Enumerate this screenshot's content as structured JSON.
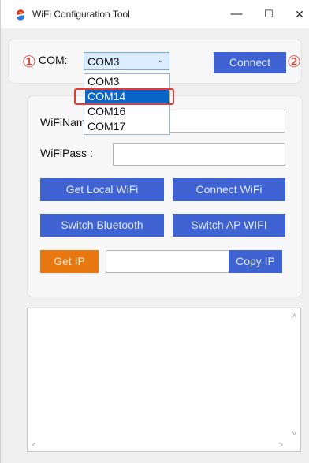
{
  "window": {
    "title": "WiFi Configuration Tool",
    "minimize_glyph": "—",
    "maximize_glyph": "☐",
    "close_glyph": "✕"
  },
  "annotations": {
    "marker1": "①",
    "marker2": "②"
  },
  "com": {
    "label": "COM:",
    "selected": "COM3",
    "options": [
      "COM3",
      "COM14",
      "COM16",
      "COM17"
    ],
    "highlighted_option": "COM14"
  },
  "buttons": {
    "connect": "Connect",
    "get_local_wifi": "Get Local WiFi",
    "connect_wifi": "Connect WiFi",
    "switch_bluetooth": "Switch Bluetooth",
    "switch_ap_wifi": "Switch AP WIFI",
    "get_ip": "Get IP",
    "copy_ip": "Copy IP"
  },
  "fields": {
    "wifi_name_label": "WiFiNam",
    "wifi_pass_label": "WiFiPass :",
    "wifi_name_value": "",
    "wifi_pass_value": "",
    "ip_value": ""
  },
  "colors": {
    "button_blue": "#3f63d2",
    "button_orange": "#e8770f",
    "highlight_red": "#e23b33",
    "selection_blue": "#0a64c8"
  }
}
